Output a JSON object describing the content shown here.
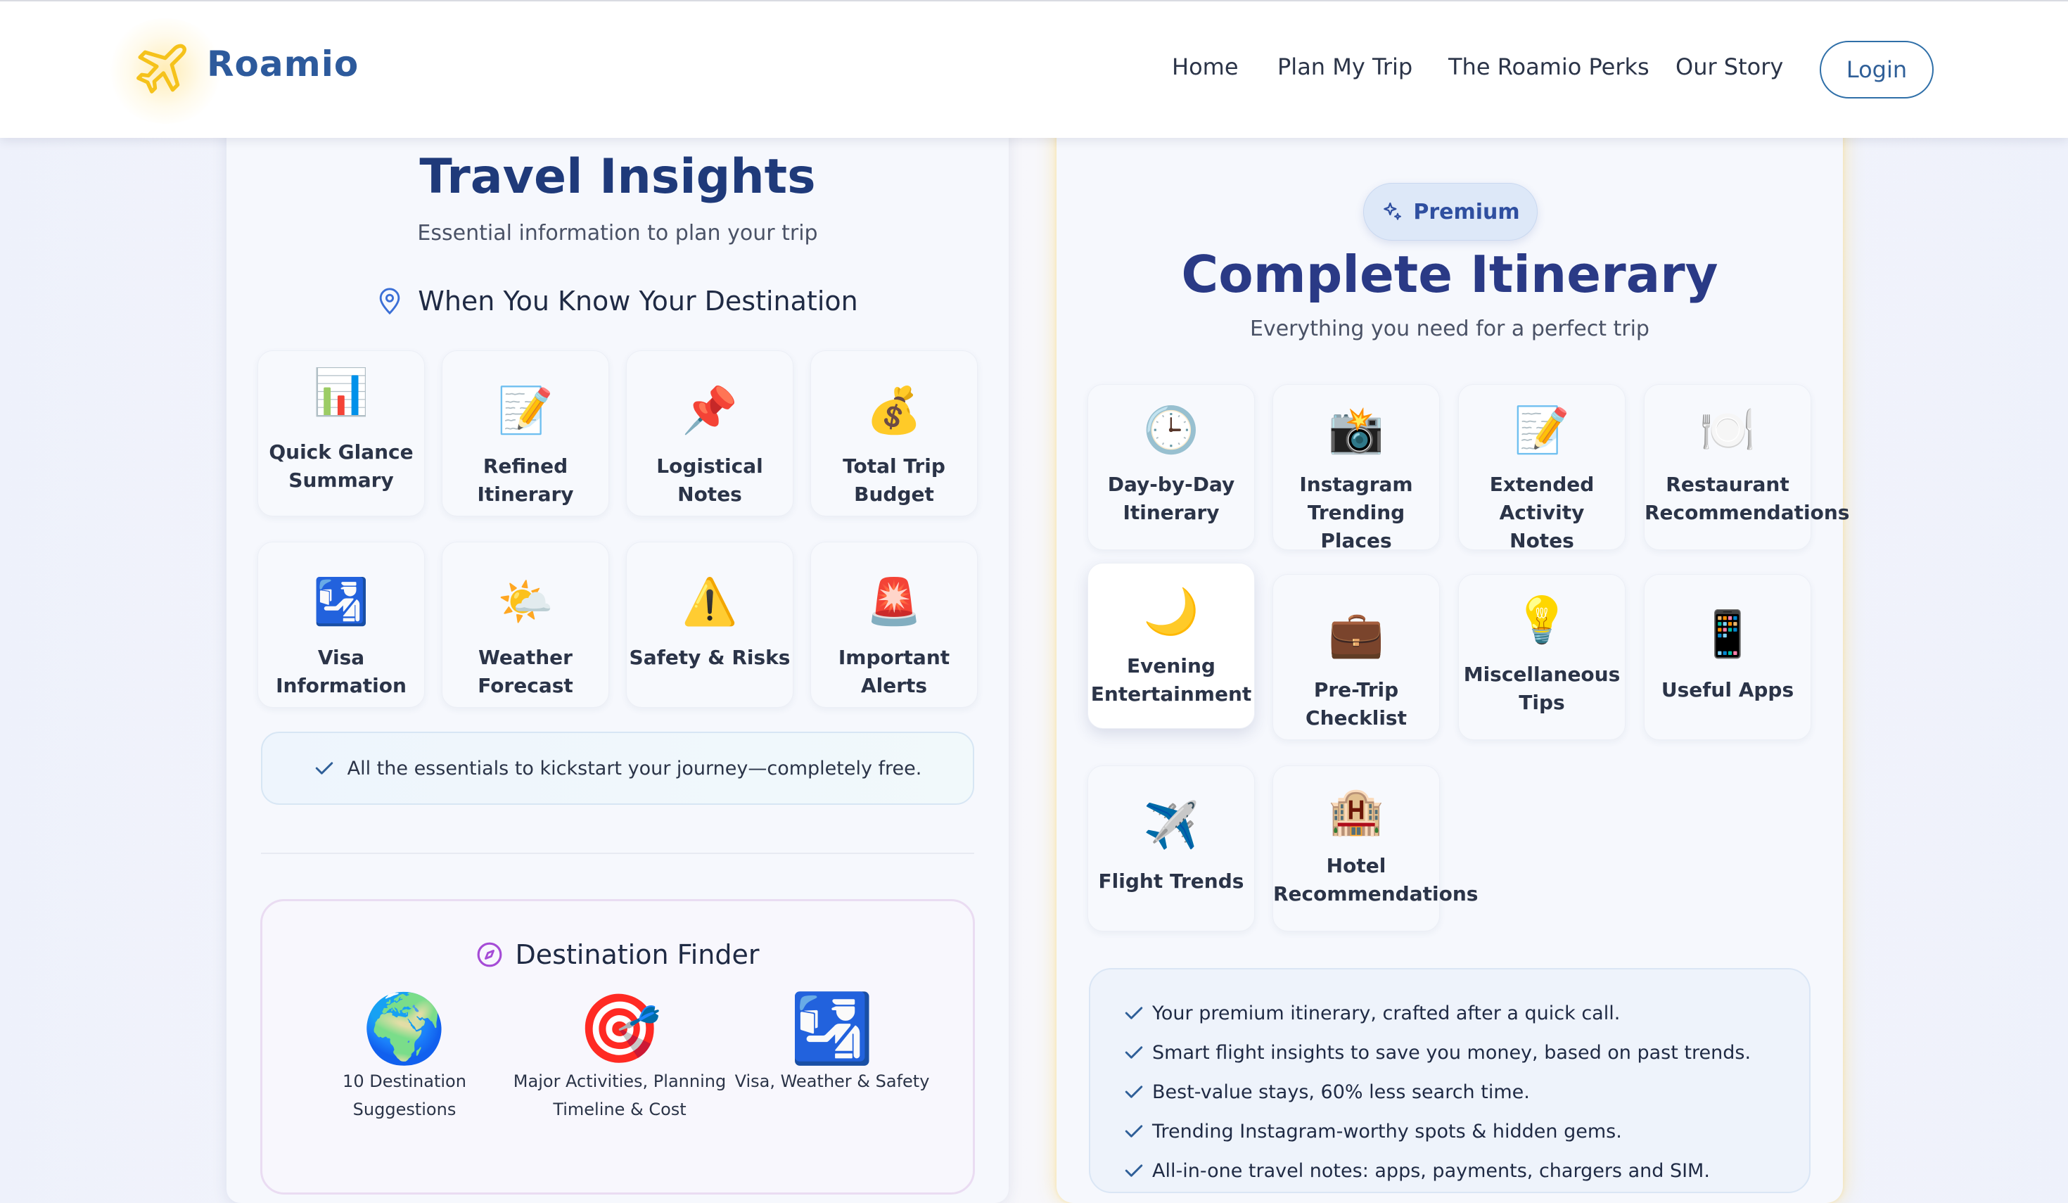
{
  "header": {
    "brand": "Roamio",
    "nav": [
      "Home",
      "Plan My Trip",
      "The Roamio Perks",
      "Our Story"
    ],
    "login": "Login",
    "logo_icon": "airplane-icon"
  },
  "insights": {
    "title": "Travel Insights",
    "subtitle": "Essential information to plan your trip",
    "section_title": "When You Know Your Destination",
    "section_icon": "map-pin-icon",
    "cards": [
      {
        "icon": "📊",
        "label": "Quick Glance\nSummary"
      },
      {
        "icon": "📝",
        "label": "Refined Itinerary"
      },
      {
        "icon": "📌",
        "label": "Logistical Notes"
      },
      {
        "icon": "💰",
        "label": "Total Trip Budget"
      },
      {
        "icon": "🛂",
        "label": "Visa Information"
      },
      {
        "icon": "🌤️",
        "label": "Weather Forecast"
      },
      {
        "icon": "⚠️",
        "label": "Safety & Risks"
      },
      {
        "icon": "🚨",
        "label": "Important Alerts"
      }
    ],
    "free_note": "All the essentials to kickstart your journey—completely free."
  },
  "finder": {
    "title": "Destination Finder",
    "icon": "compass-icon",
    "items": [
      {
        "icon": "🌍",
        "label": "10 Destination\nSuggestions"
      },
      {
        "icon": "🎯",
        "label": "Major Activities, Planning\nTimeline & Cost"
      },
      {
        "icon": "🛂",
        "label": "Visa, Weather & Safety"
      }
    ]
  },
  "premium": {
    "badge": "Premium",
    "badge_icon": "sparkles-icon",
    "title": "Complete Itinerary",
    "subtitle": "Everything you need for a perfect trip",
    "cards": [
      {
        "icon": "🕒",
        "label": "Day-by-Day\nItinerary"
      },
      {
        "icon": "📸",
        "label": "Instagram\nTrending Places"
      },
      {
        "icon": "📝",
        "label": "Extended Activity\nNotes"
      },
      {
        "icon": "🍽️",
        "label": "Restaurant\nRecommendations"
      },
      {
        "icon": "🌙",
        "label": "Evening\nEntertainment"
      },
      {
        "icon": "💼",
        "label": "Pre-Trip Checklist"
      },
      {
        "icon": "💡",
        "label": "Miscellaneous\nTips"
      },
      {
        "icon": "📱",
        "label": "Useful Apps"
      },
      {
        "icon": "✈️",
        "label": "Flight Trends"
      },
      {
        "icon": "🏨",
        "label": "Hotel\nRecommendations"
      }
    ],
    "features": [
      "Your premium itinerary, crafted after a quick call.",
      "Smart flight insights to save you money, based on past trends.",
      "Best-value stays, 60% less search time.",
      "Trending Instagram-worthy spots & hidden gems.",
      "All-in-one travel notes: apps, payments, chargers and SIM."
    ]
  },
  "colors": {
    "brand": "#2d5a9c",
    "title_blue": "#1f3a7a",
    "premium_title": "#2a3a86",
    "check": "#2f5f98",
    "premium_glow": "#f6d36a"
  }
}
